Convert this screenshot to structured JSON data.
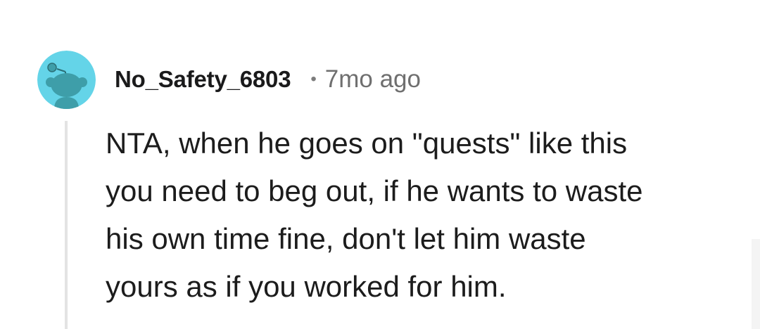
{
  "comment": {
    "username": "No_Safety_6803",
    "separator": "•",
    "timestamp": "7mo ago",
    "body_lines": [
      "NTA, when he goes on \"quests\" like this",
      "you need to beg out, if he wants to waste",
      "his own time fine, don't let him waste",
      "yours as if you worked for him."
    ]
  },
  "avatar": {
    "icon": "snoo-avatar-icon",
    "background_color": "#64d4e8",
    "head_color": "#3e9ea9"
  },
  "colors": {
    "thread_line": "#e3e3e3",
    "text": "#1c1c1c",
    "meta_text": "#6f6f6f"
  }
}
